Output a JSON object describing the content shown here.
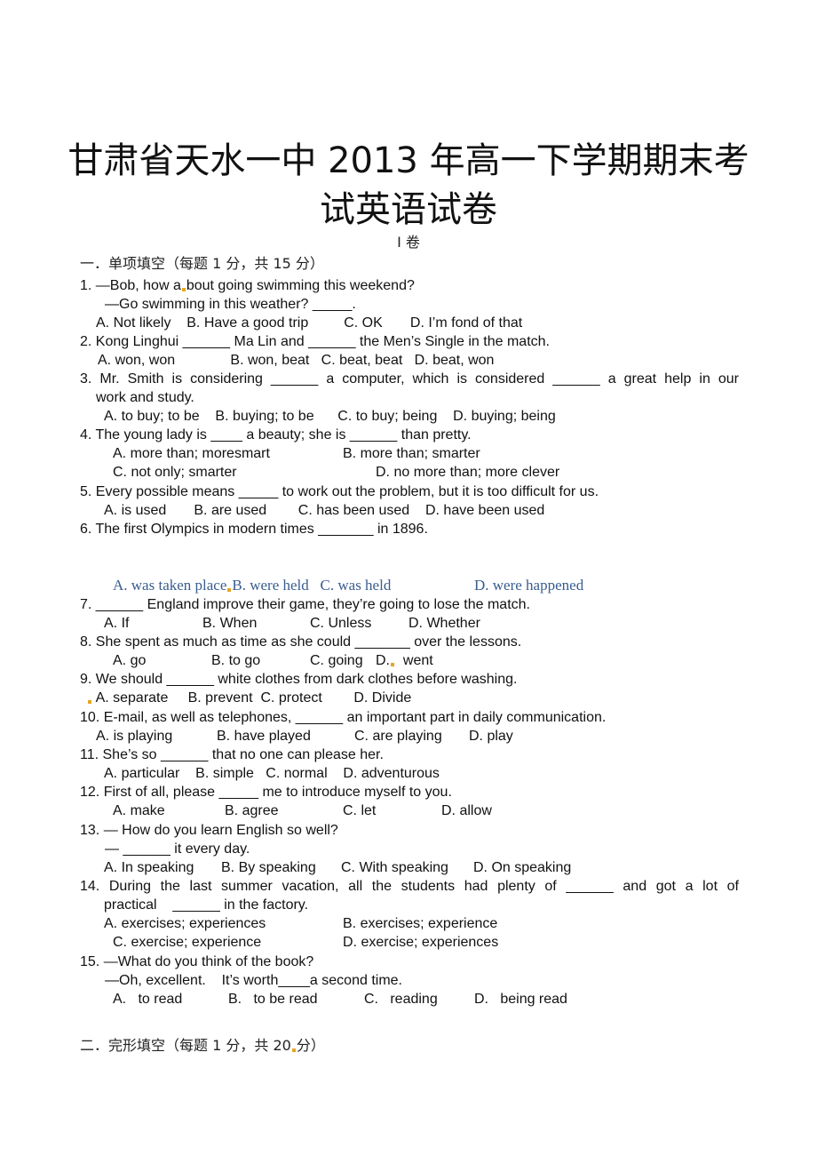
{
  "document": {
    "title_line1": "甘肃省天水一中 2013 年高一下学期期末考",
    "title_line2": "试英语试卷",
    "volume": "I 卷",
    "section1_heading": "一．单项填空（每题 1 分，共 15 分）",
    "section2_heading": "二．完形填空（每题 1 分，共 20 分）",
    "questions": [
      {
        "number": "1.",
        "stem": [
          "1. —Bob, how about going swimming this weekend?",
          "—Go swimming in this weather? _____."
        ],
        "options_lines": [
          "A. Not likely    B. Have a good trip         C. OK       D. I’m fond of that"
        ]
      },
      {
        "number": "2.",
        "stem": [
          "2. Kong Linghui ______ Ma Lin and ______ the Men’s Single in the match."
        ],
        "options_lines": [
          "A. won, won              B. won, beat   C. beat, beat   D. beat, won"
        ]
      },
      {
        "number": "3.",
        "stem": [
          "3. Mr. Smith is considering ______ a computer, which is considered ______ a great help in our",
          "work and study."
        ],
        "options_lines": [
          "A. to buy; to be    B. buying; to be      C. to buy; being    D. buying; being"
        ]
      },
      {
        "number": "4.",
        "stem": [
          "4. The young lady is ____ a beauty; she is ______ than pretty."
        ],
        "options_lines": [
          "A. more than; moresmart               B. more than; smarter",
          "C. not only; smarter                          D. no more than; more clever"
        ]
      },
      {
        "number": "5.",
        "stem": [
          "5. Every possible means _____ to work out the problem, but it is too difficult for us."
        ],
        "options_lines": [
          "A. is used       B. are used        C. has been used    D. have been used"
        ]
      },
      {
        "number": "6.",
        "stem": [
          "6. The first Olympics in modern times _______ in 1896."
        ],
        "options_lines": [
          "A. was taken place",
          "B. were held   C. was held              D. were happened"
        ]
      },
      {
        "number": "7.",
        "stem": [
          "7. ______ England improve their game, they’re going to lose the match."
        ],
        "options_lines": [
          "A. If                 B. When            C. Unless         D. Whether"
        ]
      },
      {
        "number": "8.",
        "stem": [
          "8. She spent as much as time as she could _______ over the lessons."
        ],
        "options_lines": [
          "A. go               B. to go           C. going   D.",
          "  went"
        ]
      },
      {
        "number": "9.",
        "stem": [
          "9. We should ______ white clothes from dark clothes before washing."
        ],
        "options_lines": [
          "A. separate     B. prevent  C. protect        D. Divide"
        ]
      },
      {
        "number": "10.",
        "stem": [
          "10. E-mail, as well as telephones, ______ an important part in daily communication."
        ],
        "options_lines": [
          "A. is playing          B. have played          C. are playing      D. play"
        ]
      },
      {
        "number": "11.",
        "stem": [
          "11. She’s so ______ that no one can please her."
        ],
        "options_lines": [
          "A. particular    B. simple   C. normal    D. adventurous"
        ]
      },
      {
        "number": "12.",
        "stem": [
          "12. First of all, please _____ me to introduce myself to you."
        ],
        "options_lines": [
          "A. make              B. agree                C. let                D. allow"
        ]
      },
      {
        "number": "13.",
        "stem": [
          "13. — How do you learn English so well?",
          "— ______ it every day."
        ],
        "options_lines": [
          "A. In speaking      B. By speaking      C. With speaking     D. On speaking"
        ]
      },
      {
        "number": "14.",
        "stem": [
          "14. During the last summer vacation, all the students had plenty of ______ and got a lot of",
          "practical    ______ in the factory."
        ],
        "options_lines": [
          "A. exercises; experiences                B. exercises; experience",
          "C. exercise; experience                  D. exercise; experiences"
        ]
      },
      {
        "number": "15.",
        "stem": [
          "15. —What do you think of the book?",
          "—Oh, excellent.    It’s worth____a second time."
        ],
        "options_lines": [
          "A.   to read          B.   to be read          C.   reading          D.   being read"
        ]
      }
    ],
    "accent_colors": {
      "q6_options": "#3a5d8f",
      "edit_marker": "#e6a623"
    }
  }
}
